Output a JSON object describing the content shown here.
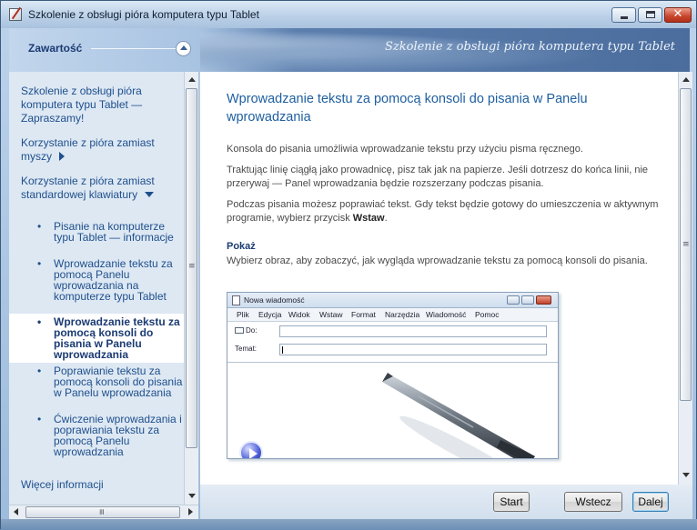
{
  "window": {
    "title": "Szkolenie z obsługi pióra komputera typu Tablet",
    "buttons": {
      "minimize": "minimize-icon",
      "maximize": "maximize-icon",
      "close": "close-icon",
      "close_glyph": "✕"
    }
  },
  "banner": {
    "contents_label": "Zawartość",
    "title": "Szkolenie z obsługi pióra komputera typu Tablet"
  },
  "sidebar": {
    "items": [
      {
        "label": "Szkolenie z obsługi pióra komputera typu Tablet — Zapraszamy!"
      },
      {
        "label": "Korzystanie z pióra zamiast myszy",
        "arrow": "right"
      },
      {
        "label": "Korzystanie z pióra zamiast standardowej klawiatury",
        "arrow": "down"
      }
    ],
    "subitems": [
      {
        "label": "Pisanie na komputerze typu Tablet — informacje",
        "selected": false
      },
      {
        "label": "Wprowadzanie tekstu za pomocą Panelu wprowadzania na komputerze typu Tablet",
        "selected": false
      },
      {
        "label": "Wprowadzanie tekstu za pomocą konsoli do pisania w Panelu wprowadzania",
        "selected": true
      },
      {
        "label": "Poprawianie tekstu za pomocą konsoli do pisania w Panelu wprowadzania",
        "selected": false
      },
      {
        "label": "Ćwiczenie wprowadzania i poprawiania tekstu za pomocą Panelu wprowadzania",
        "selected": false
      }
    ],
    "bullet": "•",
    "more_info": "Więcej informacji"
  },
  "content": {
    "heading": "Wprowadzanie tekstu za pomocą konsoli do pisania w Panelu wprowadzania",
    "p1": "Konsola do pisania umożliwia wprowadzanie tekstu przy użyciu pisma ręcznego.",
    "p2": "Traktując linię ciągłą jako prowadnicę, pisz tak jak na papierze. Jeśli dotrzesz do końca linii, nie przerywaj — Panel wprowadzania będzie rozszerzany podczas pisania.",
    "p3_before": "Podczas pisania możesz poprawiać tekst. Gdy tekst będzie gotowy do umieszczenia w aktywnym programie, wybierz przycisk ",
    "p3_bold": "Wstaw",
    "p3_after": ".",
    "show_heading": "Pokaż",
    "show_text": "Wybierz obraz, aby zobaczyć, jak wygląda wprowadzanie tekstu za pomocą konsoli do pisania."
  },
  "screenshot": {
    "title": "Nowa wiadomość",
    "menu": [
      "Plik",
      "Edycja",
      "Widok",
      "Wstaw",
      "Format",
      "Narzędzia",
      "Wiadomość",
      "Pomoc"
    ],
    "to_label": "Do:",
    "subject_label": "Temat:"
  },
  "footer": {
    "start": "Start",
    "back": "Wstecz",
    "next": "Dalej"
  },
  "scrollbar_grip": "≡"
}
